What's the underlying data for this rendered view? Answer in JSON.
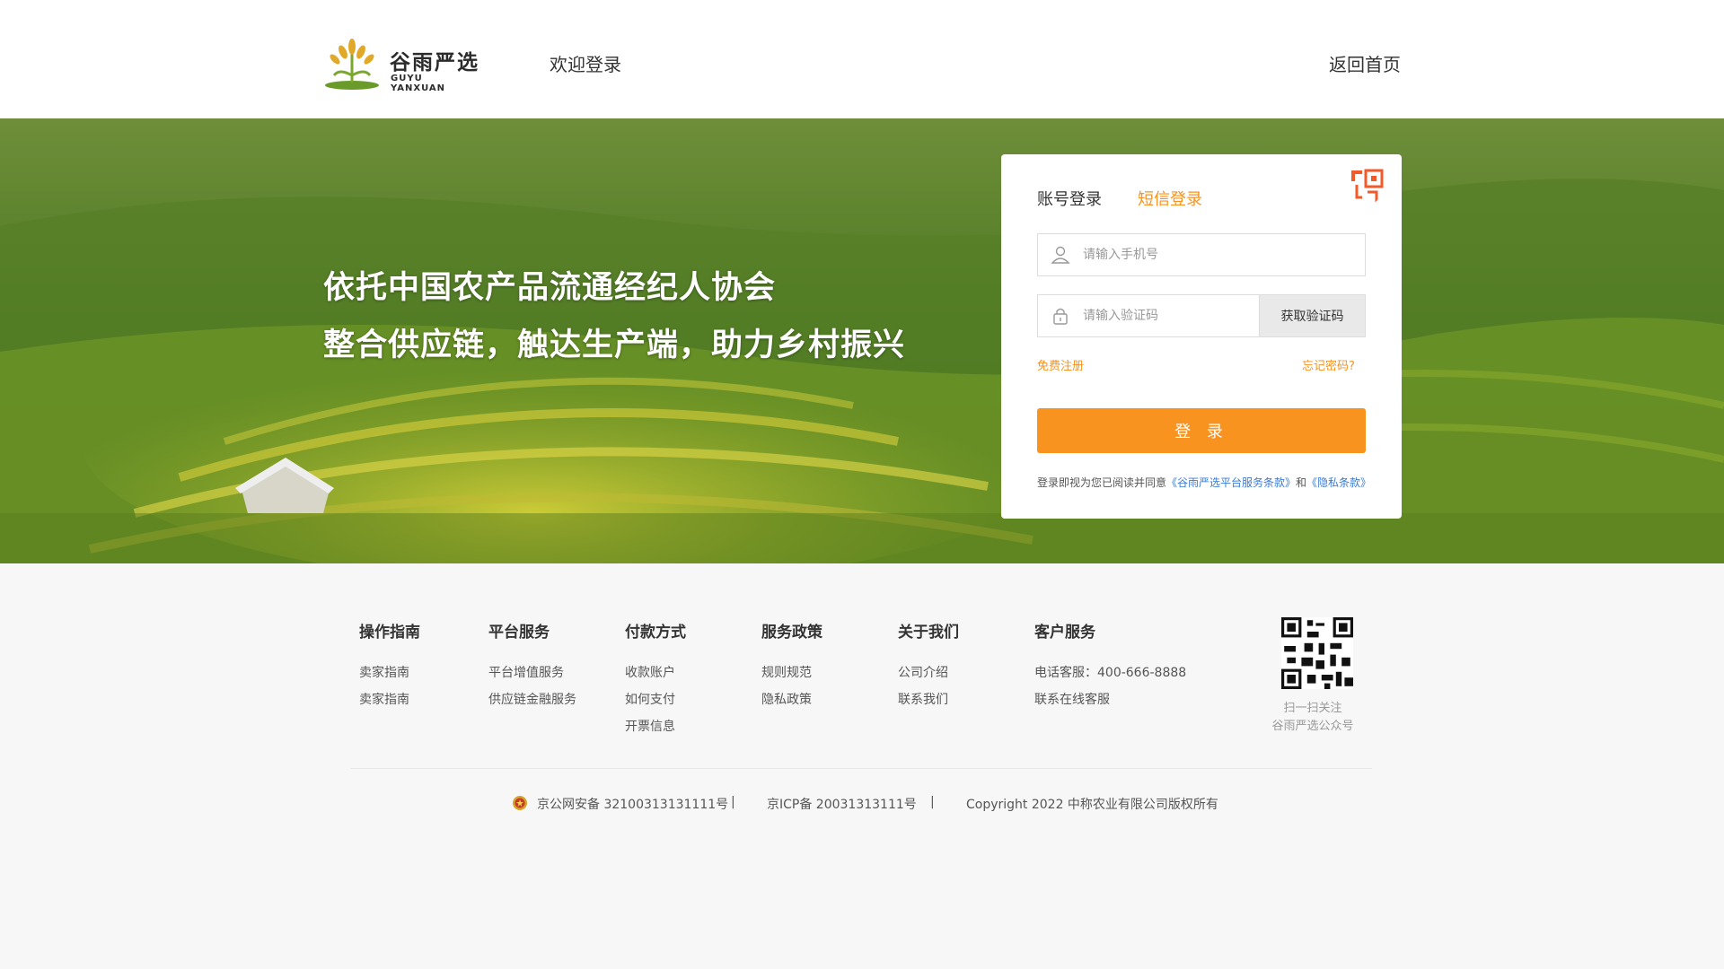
{
  "header": {
    "logo_cn": "谷雨严选",
    "logo_en": "GUYU YANXUAN",
    "welcome": "欢迎登录",
    "home_link": "返回首页"
  },
  "hero": {
    "slogan_line1": "依托中国农产品流通经纪人协会",
    "slogan_line2": "整合供应链，触达生产端，助力乡村振兴"
  },
  "login": {
    "tab_account": "账号登录",
    "tab_sms": "短信登录",
    "active_tab": "sms",
    "phone_placeholder": "请输入手机号",
    "code_placeholder": "请输入验证码",
    "get_code": "获取验证码",
    "register": "免费注册",
    "forgot": "忘记密码?",
    "submit": "登 录",
    "agree_prefix": "登录即视为您已阅读并同意",
    "terms_link": "《谷雨严选平台服务条款》",
    "agree_and": "和",
    "privacy_link": "《隐私条款》"
  },
  "footer": {
    "columns": [
      {
        "title": "操作指南",
        "links": [
          "卖家指南",
          "卖家指南"
        ]
      },
      {
        "title": "平台服务",
        "links": [
          "平台增值服务",
          "供应链金融服务"
        ]
      },
      {
        "title": "付款方式",
        "links": [
          "收款账户",
          "如何支付",
          "开票信息"
        ]
      },
      {
        "title": "服务政策",
        "links": [
          "规则规范",
          "隐私政策"
        ]
      },
      {
        "title": "关于我们",
        "links": [
          "公司介绍",
          "联系我们"
        ]
      },
      {
        "title": "客户服务",
        "links": [
          "电话客服：400-666-8888",
          "联系在线客服"
        ]
      }
    ],
    "qr_text_line1": "扫一扫关注",
    "qr_text_line2": "谷雨严选公众号",
    "police_record": "京公网安备 32100313131111号",
    "separator": "|",
    "icp_record": "京ICP备 20031313111号",
    "copyright": "Copyright 2022 中称农业有限公司版权所有"
  },
  "colors": {
    "accent": "#f7931e",
    "link_blue": "#3a7bd5",
    "footer_bg": "#f7f7f7"
  }
}
